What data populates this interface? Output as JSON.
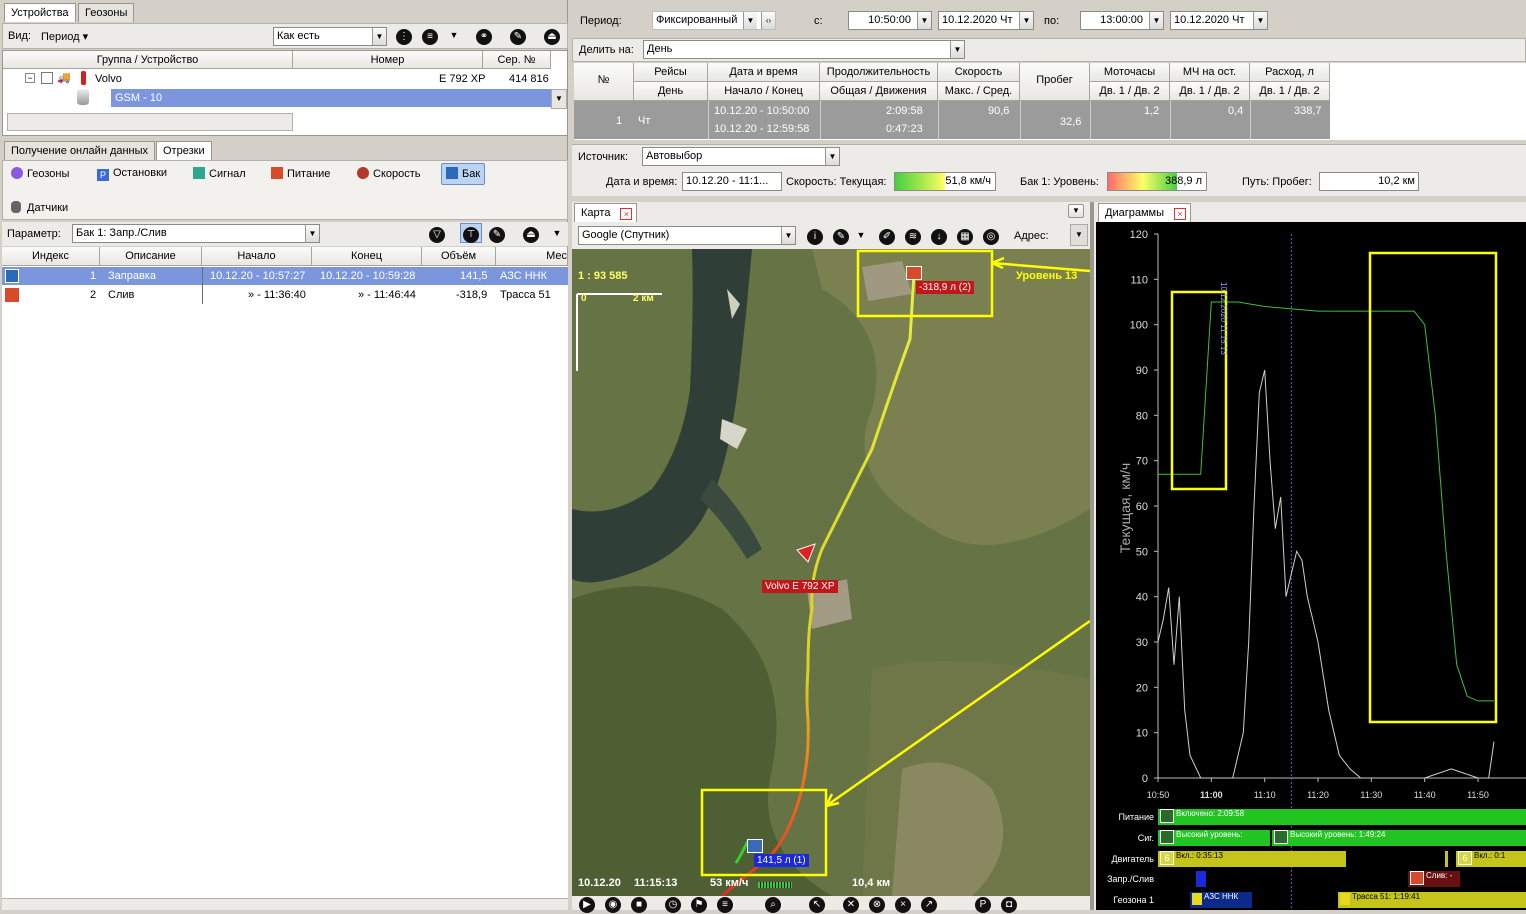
{
  "left": {
    "tabs": [
      "Устройства",
      "Геозоны"
    ],
    "view_label": "Вид:",
    "view_mode": "Период",
    "view_select": "Как есть",
    "device_table": {
      "headers": [
        "Группа / Устройство",
        "Номер",
        "Сер. №"
      ],
      "group": {
        "name": "Volvo",
        "number": "Е 792 ХР",
        "serial": "414 816"
      },
      "selected_item": "GSM - 10"
    },
    "bottom_tabs": [
      "Получение онлайн данных",
      "Отрезки"
    ],
    "segment_tabs": [
      "Геозоны",
      "Остановки",
      "Сигнал",
      "Питание",
      "Скорость",
      "Бак"
    ],
    "sensors_label": "Датчики",
    "param_label": "Параметр:",
    "param_value": "Бак 1: Запр./Слив",
    "events_headers": [
      "Индекс",
      "Описание",
      "Начало",
      "Конец",
      "Объём",
      "Мес"
    ],
    "events": [
      {
        "index": "1",
        "desc": "Заправка",
        "start": "10.12.20 - 10:57:27",
        "end": "10.12.20 - 10:59:28",
        "volume": "141,5",
        "place": "АЗС ННК"
      },
      {
        "index": "2",
        "desc": "Слив",
        "start": "» - 11:36:40",
        "end": "» - 11:46:44",
        "volume": "-318,9",
        "place": "Трасса 51"
      }
    ]
  },
  "top": {
    "period_label": "Период:",
    "period_value": "Фиксированный",
    "from_label": "с:",
    "from_time": "10:50:00",
    "from_date": "10.12.2020 Чт",
    "to_label": "по:",
    "to_time": "13:00:00",
    "to_date": "10.12.2020 Чт",
    "split_label": "Делить на:",
    "split_value": "День"
  },
  "summary": {
    "h1": [
      "№",
      "Рейсы",
      "Дата и время",
      "Продолжительность",
      "Скорость",
      "Пробег",
      "Моточасы",
      "МЧ на ост.",
      "Расход, л"
    ],
    "h2": [
      "День",
      "Начало / Конец",
      "Общая / Движения",
      "Макс. / Сред.",
      "Дв. 1 / Дв. 2",
      "Дв. 1 / Дв. 2",
      "Дв. 1 / Дв. 2"
    ],
    "row": {
      "num": "1",
      "day": "Чт",
      "start": "10.12.20 - 10:50:00",
      "end": "10.12.20 - 12:59:58",
      "dur_total": "2:09:58",
      "dur_move": "0:47:23",
      "speed_max": "90,6",
      "mileage": "32,6",
      "moto": "1,2",
      "mch": "0,4",
      "fuel": "338,7"
    }
  },
  "status": {
    "source_label": "Источник:",
    "source_value": "Автовыбор",
    "dt_label": "Дата и время:",
    "dt_value": "10.12.20 - 11:1...",
    "speed_label": "Скорость: Текущая:",
    "speed_value": "51,8 км/ч",
    "speed_fill": 0.5,
    "tank_label": "Бак 1: Уровень:",
    "tank_value": "388,9 л",
    "tank_fill": 0.7,
    "path_label": "Путь: Пробег:",
    "path_value": "10,2 км"
  },
  "map": {
    "tab": "Карта",
    "provider": "Google (Спутник)",
    "address_label": "Адрес:",
    "scale": "1 : 93 585",
    "scale_zero": "0",
    "scale_km": "2 км",
    "vehicle_label": "Volvo Е 792 ХР",
    "drain_label": "-318,9 л (2)",
    "refuel_label": "141,5 л (1)",
    "level_label": "Уровень 13",
    "footer_date": "10.12.20",
    "footer_time": "11:15:13",
    "footer_speed": "53 км/ч",
    "footer_dist": "10,4 км"
  },
  "diagram": {
    "tab": "Диаграммы",
    "ylabel": "Текущая, км/ч",
    "cursor_label": "10.12.2020 11:15:13",
    "events": [
      {
        "label": "Питание",
        "items": [
          "Включено: 2:09:58"
        ]
      },
      {
        "label": "Сиг.",
        "items": [
          "Высокий уровень:",
          "Высокий уровень: 1:49:24"
        ]
      },
      {
        "label": "Двигатель",
        "items": [
          "Вкл.: 0:35:13",
          "Вкл.: 0:1"
        ]
      },
      {
        "label": "Запр./Слив",
        "items": [
          "Слив: -"
        ]
      },
      {
        "label": "Геозона 1",
        "items": [
          "АЗС ННК",
          "Трасса 51: 1:19:41"
        ]
      }
    ]
  },
  "chart_data": {
    "type": "line",
    "title": "",
    "xlabel": "",
    "ylabel": "Текущая, км/ч",
    "ylim": [
      0,
      120
    ],
    "yticks": [
      0,
      10,
      20,
      30,
      40,
      50,
      60,
      70,
      80,
      90,
      100,
      110,
      120
    ],
    "xticks": [
      "10:50",
      "11:00",
      "11:10",
      "11:20",
      "11:30",
      "11:40",
      "11:50"
    ],
    "grid": true,
    "series": [
      {
        "name": "",
        "color": "#cfcfcf",
        "x": [
          "10:50",
          "10:51",
          "10:52",
          "10:53",
          "10:54",
          "10:55",
          "10:56",
          "10:58",
          "11:00",
          "11:02",
          "11:04",
          "11:06",
          "11:07",
          "11:08",
          "11:09",
          "11:10",
          "11:11",
          "11:12",
          "11:13",
          "11:14",
          "11:15",
          "11:16",
          "11:17",
          "11:18",
          "11:19",
          "11:20",
          "11:22",
          "11:24",
          "11:26",
          "11:28",
          "11:30",
          "11:35",
          "11:40",
          "11:45",
          "11:50",
          "11:52",
          "11:53"
        ],
        "y": [
          30,
          35,
          42,
          25,
          40,
          15,
          5,
          0,
          0,
          0,
          0,
          10,
          30,
          60,
          85,
          90,
          70,
          55,
          62,
          40,
          45,
          50,
          48,
          40,
          35,
          30,
          15,
          5,
          2,
          0,
          0,
          0,
          0,
          2,
          0,
          0,
          8
        ]
      },
      {
        "name": "",
        "color": "#3fbf3f",
        "x": [
          "10:50",
          "10:52",
          "10:53",
          "10:54",
          "10:55",
          "10:56",
          "10:58",
          "11:00",
          "11:05",
          "11:10",
          "11:20",
          "11:30",
          "11:35",
          "11:38",
          "11:40",
          "11:42",
          "11:44",
          "11:46",
          "11:48",
          "11:50",
          "11:52",
          "11:53"
        ],
        "y": [
          67,
          67,
          67,
          67,
          67,
          67,
          67,
          105,
          105,
          104,
          103,
          103,
          103,
          103,
          100,
          80,
          50,
          25,
          18,
          17,
          17,
          17
        ]
      }
    ]
  }
}
